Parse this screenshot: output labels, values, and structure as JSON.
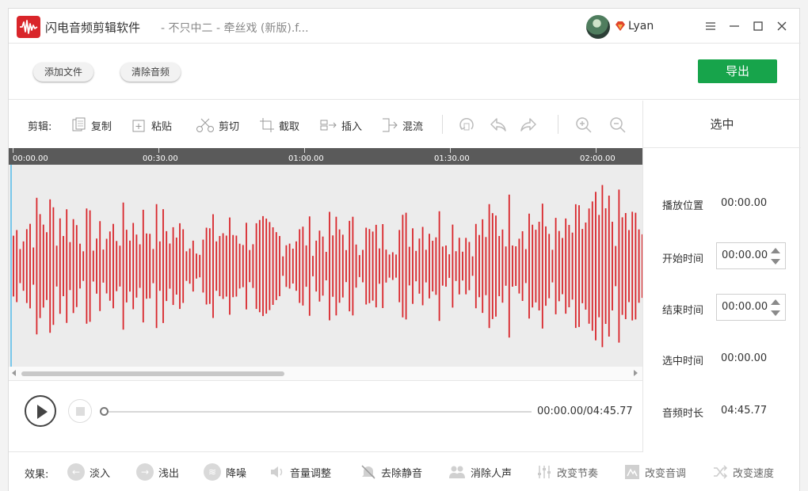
{
  "window": {
    "app_title": "闪电音频剪辑软件",
    "doc_title": "- 不只中二 - 牵丝戏 (新版).f...",
    "username": "Lyan"
  },
  "actions": {
    "add_file": "添加文件",
    "clear_audio": "清除音频",
    "export": "导出"
  },
  "edit_toolbar": {
    "label": "剪辑:",
    "items": [
      {
        "label": "复制",
        "icon": "copy-icon"
      },
      {
        "label": "粘贴",
        "icon": "paste-icon"
      },
      {
        "label": "剪切",
        "icon": "scissors-icon"
      },
      {
        "label": "截取",
        "icon": "crop-icon"
      },
      {
        "label": "插入",
        "icon": "insert-icon"
      },
      {
        "label": "混流",
        "icon": "mix-icon"
      }
    ],
    "icon_buttons": [
      "loop-icon",
      "undo-icon",
      "redo-icon",
      "zoom-in-icon",
      "zoom-out-icon"
    ]
  },
  "timeline": {
    "ticks": [
      "00:00.00",
      "00:30.00",
      "01:00.00",
      "01:30.00",
      "02:00.00"
    ],
    "waveform_color": "#d9252a"
  },
  "player": {
    "time": "00:00.00/04:45.77",
    "progress": 0
  },
  "selection_panel": {
    "title": "选中",
    "play_position_label": "播放位置",
    "play_position_value": "00:00.00",
    "start_time_label": "开始时间",
    "start_time_value": "00:00.00",
    "end_time_label": "结束时间",
    "end_time_value": "00:00.00",
    "selected_time_label": "选中时间",
    "selected_time_value": "00:00.00",
    "duration_label": "音频时长",
    "duration_value": "04:45.77"
  },
  "effects": {
    "label": "效果:",
    "items": [
      {
        "label": "淡入",
        "icon": "arrow-left-icon"
      },
      {
        "label": "浅出",
        "icon": "arrow-right-icon"
      },
      {
        "label": "降噪",
        "icon": "noise-reduction-icon"
      },
      {
        "label": "音量调整",
        "icon": "volume-icon"
      },
      {
        "label": "去除静音",
        "icon": "mute-icon"
      },
      {
        "label": "消除人声",
        "icon": "people-icon"
      },
      {
        "label": "改变节奏",
        "icon": "equalizer-icon"
      },
      {
        "label": "改变音调",
        "icon": "pitch-icon"
      },
      {
        "label": "改变速度",
        "icon": "shuffle-icon"
      }
    ]
  },
  "colors": {
    "accent_green": "#17a44b",
    "brand_red": "#d9252a"
  }
}
